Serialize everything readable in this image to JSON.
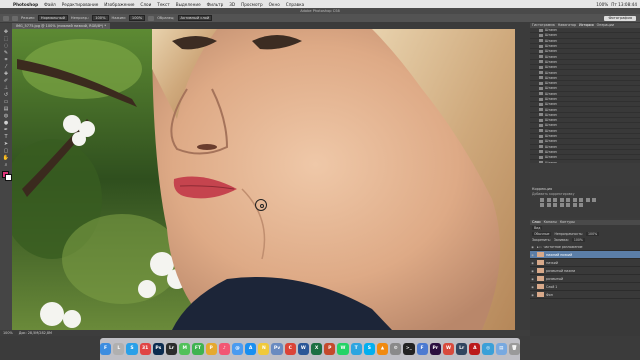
{
  "menubar": {
    "app_name": "Photoshop",
    "items": [
      "Файл",
      "Редактирование",
      "Изображение",
      "Слои",
      "Текст",
      "Выделение",
      "Фильтр",
      "3D",
      "Просмотр",
      "Окно",
      "Справка"
    ],
    "right": [
      "100%",
      "Пт 13:08:44"
    ]
  },
  "window": {
    "title": "Adobe Photoshop CS6"
  },
  "options_bar": {
    "mode_label": "Режим:",
    "mode_value": "Нормальный",
    "opacity_label": "Непрозр.:",
    "opacity_value": "100%",
    "flow_label": "Нажим:",
    "flow_value": "100%",
    "sample_label": "Образец:",
    "sample_value": "Активный слой",
    "workspace": "Фотография"
  },
  "document": {
    "tab_label": "IMG_5775.jpg @ 100% (нижний низкий, RGB/8*) *",
    "zoom": "100%",
    "doc_info": "Док: 28,5M/282,8M"
  },
  "panels": {
    "top_tabs": [
      "Гистограмма",
      "Навигатор",
      "История",
      "Операции"
    ],
    "active_top_tab": "История",
    "history_item": "Штамп",
    "adjustments_title": "Коррекция",
    "adjustments_sub": "Добавить корректировку",
    "layer_tabs": [
      "Слои",
      "Каналы",
      "Контуры"
    ],
    "layer_kind": "Вид",
    "blend_mode": "Обычные",
    "opacity_label": "Непрозрачность:",
    "opacity_value": "100%",
    "lock_label": "Закрепить:",
    "fill_label": "Заливка:",
    "fill_value": "100%",
    "group_name": "частотное разложение",
    "layers": [
      "нижний низкий",
      "низкий",
      "размытый нижни",
      "размытый",
      "Слой 1",
      "Фон"
    ],
    "selected_layer_index": 0
  },
  "dock": {
    "apps": [
      {
        "name": "finder",
        "label": "F",
        "color": "#3d8de0"
      },
      {
        "name": "launchpad",
        "label": "L",
        "color": "#b0b0b0"
      },
      {
        "name": "safari",
        "label": "S",
        "color": "#2aa0e8"
      },
      {
        "name": "calendar",
        "label": "31",
        "color": "#e04444"
      },
      {
        "name": "photoshop",
        "label": "Ps",
        "color": "#0b2b4f"
      },
      {
        "name": "lightroom",
        "label": "Lr",
        "color": "#2c2c2c"
      },
      {
        "name": "messages",
        "label": "M",
        "color": "#52c15a"
      },
      {
        "name": "facetime",
        "label": "FT",
        "color": "#3fb34f"
      },
      {
        "name": "photos",
        "label": "P",
        "color": "#e5a92f"
      },
      {
        "name": "music",
        "label": "♪",
        "color": "#f25673"
      },
      {
        "name": "mail",
        "label": "@",
        "color": "#4a9bf0"
      },
      {
        "name": "appstore",
        "label": "A",
        "color": "#1a8ff0"
      },
      {
        "name": "notes",
        "label": "N",
        "color": "#f0c93a"
      },
      {
        "name": "preview",
        "label": "Pv",
        "color": "#6a8bc0"
      },
      {
        "name": "chrome",
        "label": "C",
        "color": "#db4437"
      },
      {
        "name": "word",
        "label": "W",
        "color": "#2b5797"
      },
      {
        "name": "excel",
        "label": "X",
        "color": "#1d6f42"
      },
      {
        "name": "powerpoint",
        "label": "P",
        "color": "#c44a2b"
      },
      {
        "name": "whatsapp",
        "label": "W",
        "color": "#25d366"
      },
      {
        "name": "telegram",
        "label": "T",
        "color": "#2ca5e0"
      },
      {
        "name": "skype",
        "label": "S",
        "color": "#00aff0"
      },
      {
        "name": "vlc",
        "label": "▲",
        "color": "#f08a10"
      },
      {
        "name": "settings",
        "label": "⚙",
        "color": "#8a8a8a"
      },
      {
        "name": "terminal",
        "label": ">_",
        "color": "#222222"
      },
      {
        "name": "finder2",
        "label": "F",
        "color": "#4c7bd1"
      },
      {
        "name": "premiere",
        "label": "Pr",
        "color": "#2a0f40"
      },
      {
        "name": "wunderlist",
        "label": "W",
        "color": "#d84a3c"
      },
      {
        "name": "lr-classic",
        "label": "Lr",
        "color": "#31455f"
      },
      {
        "name": "pdf",
        "label": "A",
        "color": "#bb1a1a"
      },
      {
        "name": "globe",
        "label": "◎",
        "color": "#3aa0d8"
      },
      {
        "name": "folder",
        "label": "▤",
        "color": "#78a9e0"
      },
      {
        "name": "trash",
        "label": "🗑",
        "color": "#9a9a9a"
      }
    ]
  }
}
